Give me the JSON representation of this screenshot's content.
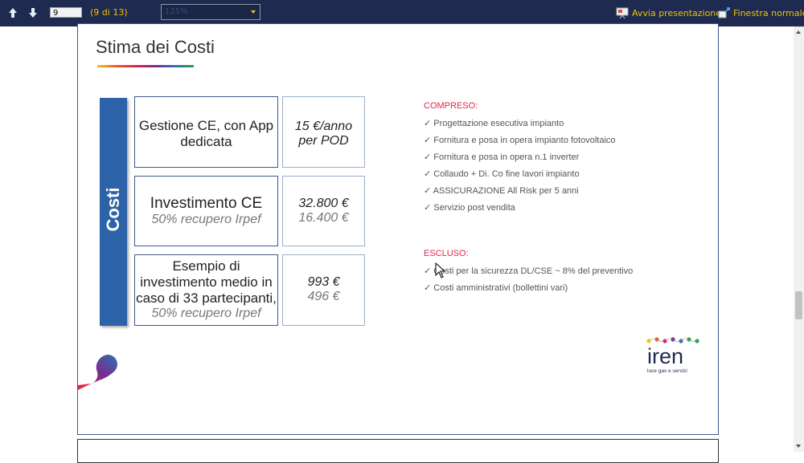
{
  "toolbar": {
    "page_number": "9",
    "page_count": "(9 di 13)",
    "zoom": "125%",
    "start_presentation": "Avvia presentazione",
    "normal_window": "Finestra normale",
    "icons": [
      "scroll-up-icon",
      "scroll-down-icon",
      "presentation-icon",
      "window-icon"
    ]
  },
  "slide": {
    "title": "Stima dei Costi",
    "side_label": "Costi",
    "rows": [
      {
        "desc": [
          "Gestione CE, con App",
          "dedicata"
        ],
        "price": [
          "15 €/anno",
          "per POD"
        ]
      },
      {
        "desc": [
          "Investimento CE"
        ],
        "desc_sub": "50% recupero Irpef",
        "price": "32.800 €",
        "price_sub": "16.400  €"
      },
      {
        "desc": [
          "Esempio di",
          "investimento medio in",
          "caso di 33 partecipanti,"
        ],
        "desc_sub": "50% recupero Irpef",
        "price": "993 €",
        "price_sub": "496 €"
      }
    ],
    "included": {
      "heading": "COMPRESO:",
      "items": [
        "✓ Progettazione esecutiva impianto",
        "✓ Fornitura e posa in opera impianto fotovoltaico",
        "✓ Fornitura e posa in opera n.1 inverter",
        "✓ Collaudo + Di. Co fine lavori impianto",
        "✓ ASSICURAZIONE All Risk per 5 anni",
        "✓ Servizio post vendita"
      ]
    },
    "excluded": {
      "heading": "ESCLUSO:",
      "items": [
        "✓ Costi per la sicurezza DL/CSE ~ 8% del preventivo",
        "✓ Costi amministrativi (bollettini vari)"
      ]
    },
    "logo": {
      "text": "iren",
      "tagline": "luce gas e servizi"
    }
  },
  "colors": {
    "toolbar_bg": "#1e2a4f",
    "toolbar_text": "#f2c200",
    "accent_blue": "#2c62a7",
    "accent_red": "#e8224b"
  }
}
